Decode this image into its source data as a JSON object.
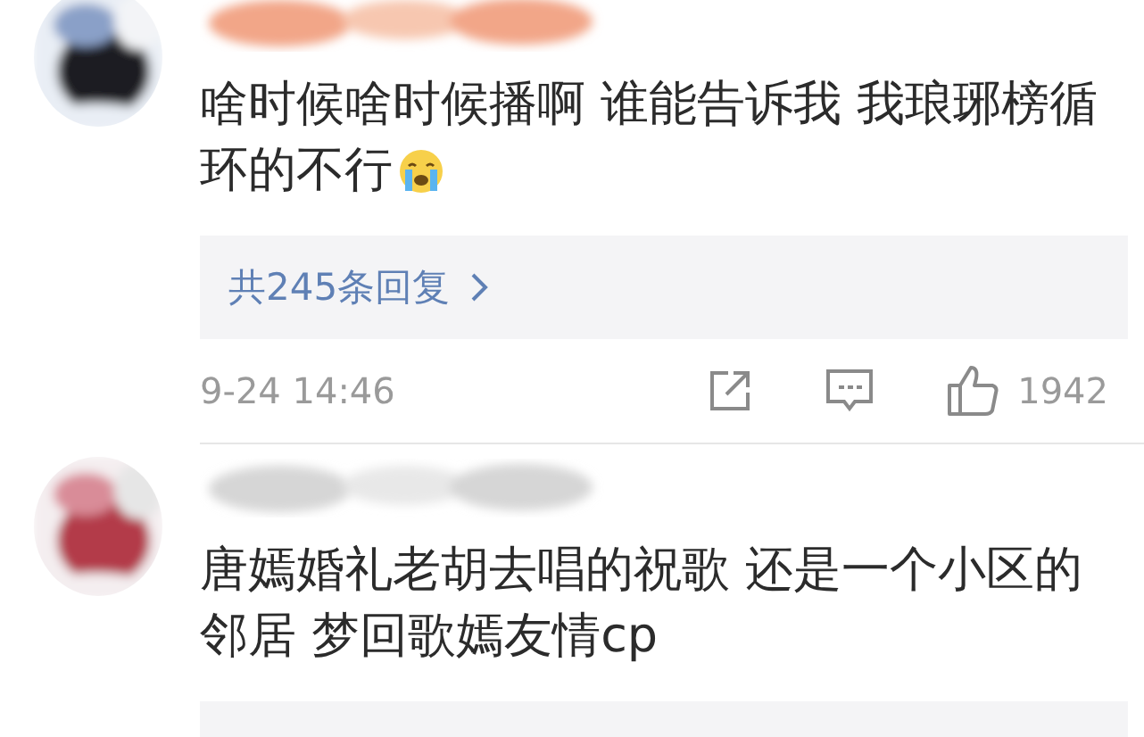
{
  "comments": [
    {
      "name_redacted": true,
      "text": "啥时候啥时候播啊 谁能告诉我 我琅琊榜循环的不行",
      "trailing_emoji": true,
      "reply_panel": true,
      "replies": "共245条回复",
      "date": "9-24 14:46",
      "likes": "1942"
    },
    {
      "name_redacted": true,
      "text": "唐嫣婚礼老胡去唱的祝歌 还是一个小区的邻居 梦回歌嫣友情cp",
      "trailing_emoji": false,
      "reply_panel": true
    }
  ]
}
